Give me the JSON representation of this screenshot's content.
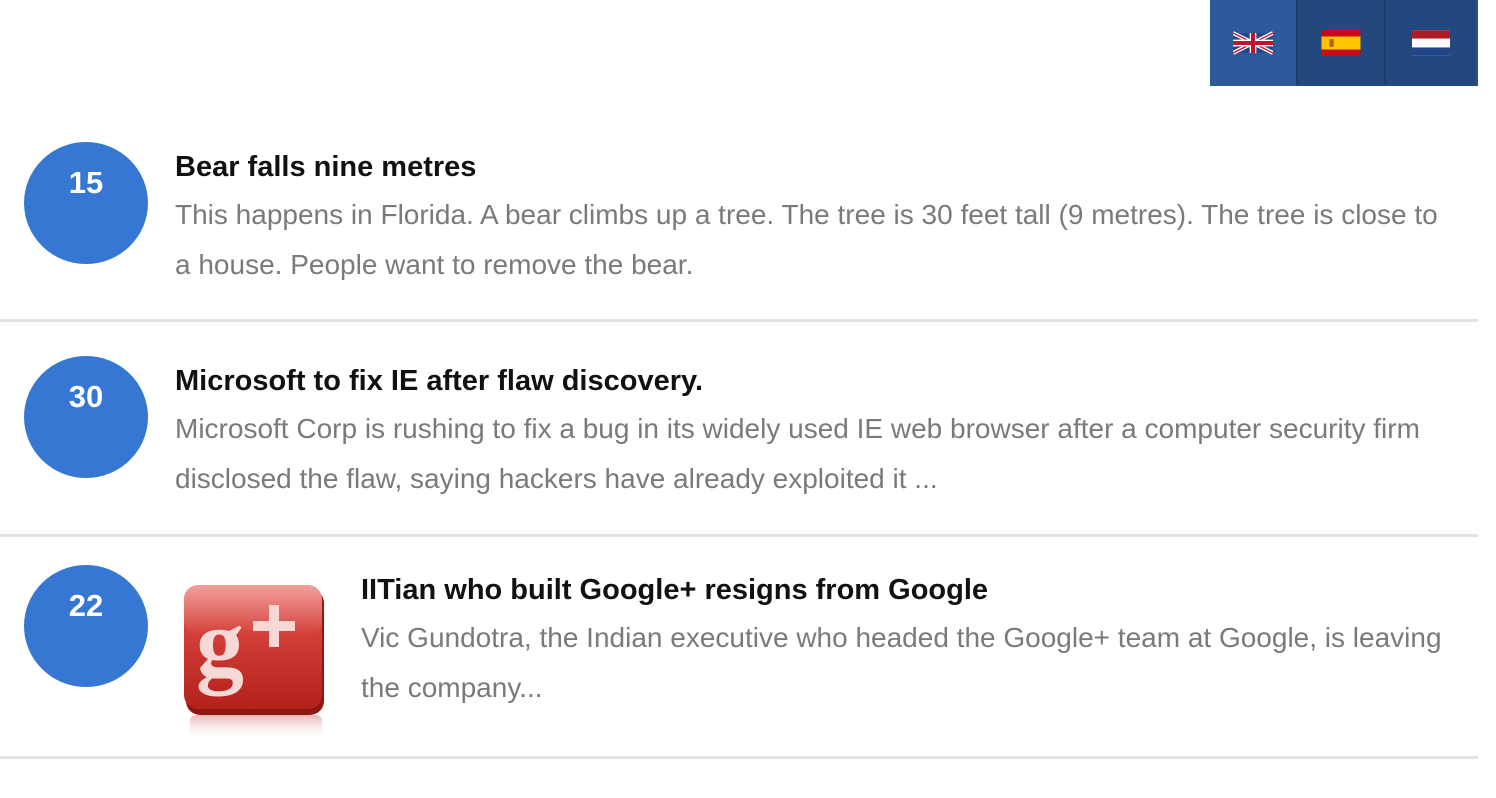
{
  "languages": [
    {
      "name": "English",
      "icon": "uk-flag-icon"
    },
    {
      "name": "Español",
      "icon": "spain-flag-icon"
    },
    {
      "name": "Nederlands",
      "icon": "netherlands-flag-icon"
    }
  ],
  "news": [
    {
      "count": "15",
      "title": "Bear falls nine metres",
      "description": "This happens in Florida. A bear climbs up a tree. The tree is 30 feet tall (9 metres). The tree is close to a house. People want to remove the bear."
    },
    {
      "count": "30",
      "title": "Microsoft to fix IE after flaw discovery.",
      "description": "Microsoft Corp is rushing to fix a bug in its widely used IE web browser after a computer security firm disclosed the flaw, saying hackers have already exploited it ..."
    },
    {
      "count": "22",
      "title": "IITian who built Google+ resigns from Google",
      "description": "Vic Gundotra, the Indian executive who headed the Google+ team at Google, is leaving the company...",
      "thumbnail_icon": "google-plus-logo-icon"
    }
  ],
  "colors": {
    "badge": "#3677d3",
    "lang_bar": "#2a4f86",
    "title": "#111111",
    "description": "#7a7a7a",
    "divider": "#e3e3e3"
  }
}
